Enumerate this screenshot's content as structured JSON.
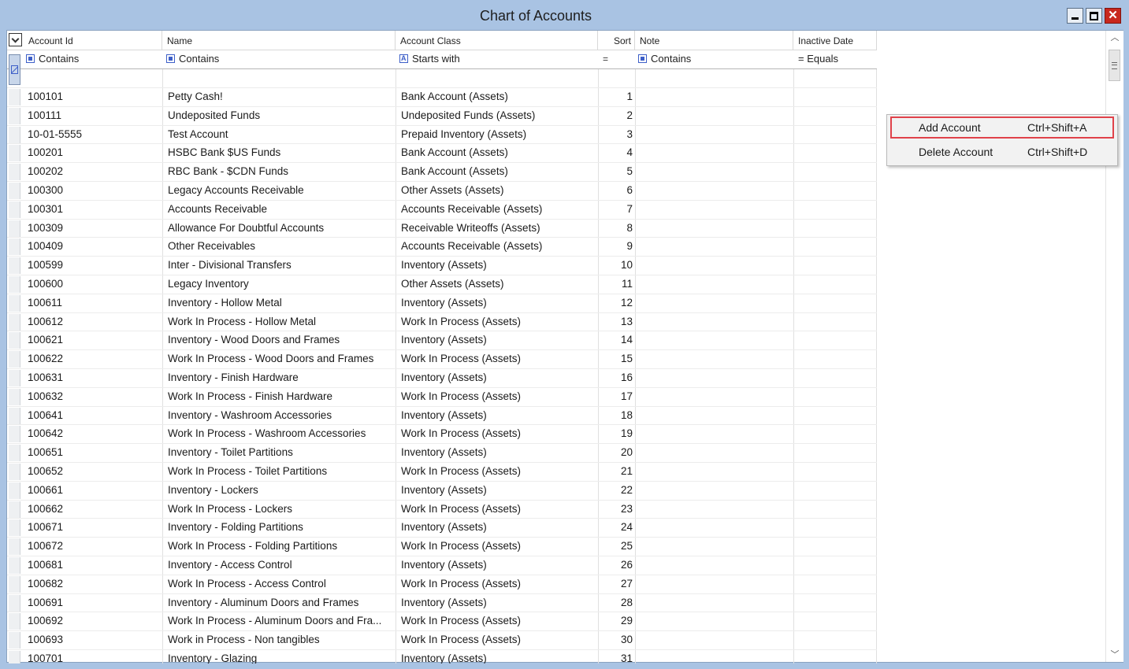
{
  "window": {
    "title": "Chart of Accounts",
    "close_glyph": "✕"
  },
  "columns": {
    "account_id": "Account Id",
    "name": "Name",
    "account_class": "Account Class",
    "sort": "Sort",
    "note": "Note",
    "inactive_date": "Inactive Date"
  },
  "filters": {
    "account_id": "Contains",
    "name": "Contains",
    "account_class": "Starts with",
    "sort": "=",
    "note": "Contains",
    "inactive_date": "= Equals"
  },
  "context_menu": {
    "items": [
      {
        "label": "Add Account",
        "shortcut": "Ctrl+Shift+A"
      },
      {
        "label": "Delete Account",
        "shortcut": "Ctrl+Shift+D"
      }
    ]
  },
  "rows": [
    {
      "id": "100101",
      "name": "Petty Cash!",
      "class": "Bank Account (Assets)",
      "sort": "1"
    },
    {
      "id": "100111",
      "name": "Undeposited Funds",
      "class": "Undeposited Funds (Assets)",
      "sort": "2"
    },
    {
      "id": "10-01-5555",
      "name": "Test Account",
      "class": "Prepaid Inventory (Assets)",
      "sort": "3"
    },
    {
      "id": "100201",
      "name": "HSBC Bank  $US Funds",
      "class": "Bank Account (Assets)",
      "sort": "4"
    },
    {
      "id": "100202",
      "name": "RBC Bank -  $CDN Funds",
      "class": "Bank Account (Assets)",
      "sort": "5"
    },
    {
      "id": "100300",
      "name": "Legacy Accounts Receivable",
      "class": "Other Assets (Assets)",
      "sort": "6"
    },
    {
      "id": "100301",
      "name": "Accounts Receivable",
      "class": "Accounts Receivable (Assets)",
      "sort": "7"
    },
    {
      "id": "100309",
      "name": "Allowance For Doubtful Accounts",
      "class": "Receivable Writeoffs (Assets)",
      "sort": "8"
    },
    {
      "id": "100409",
      "name": "Other Receivables",
      "class": "Accounts Receivable (Assets)",
      "sort": "9"
    },
    {
      "id": "100599",
      "name": "Inter - Divisional Transfers",
      "class": "Inventory (Assets)",
      "sort": "10"
    },
    {
      "id": "100600",
      "name": "Legacy Inventory",
      "class": "Other Assets (Assets)",
      "sort": "11"
    },
    {
      "id": "100611",
      "name": "Inventory - Hollow Metal",
      "class": "Inventory (Assets)",
      "sort": "12"
    },
    {
      "id": "100612",
      "name": "Work In Process - Hollow Metal",
      "class": "Work In Process (Assets)",
      "sort": "13"
    },
    {
      "id": "100621",
      "name": "Inventory - Wood Doors and Frames",
      "class": "Inventory (Assets)",
      "sort": "14"
    },
    {
      "id": "100622",
      "name": "Work In Process - Wood Doors and Frames",
      "class": "Work In Process (Assets)",
      "sort": "15"
    },
    {
      "id": "100631",
      "name": "Inventory - Finish Hardware",
      "class": "Inventory (Assets)",
      "sort": "16"
    },
    {
      "id": "100632",
      "name": "Work In Process - Finish Hardware",
      "class": "Work In Process (Assets)",
      "sort": "17"
    },
    {
      "id": "100641",
      "name": "Inventory - Washroom Accessories",
      "class": "Inventory (Assets)",
      "sort": "18"
    },
    {
      "id": "100642",
      "name": "Work In Process - Washroom Accessories",
      "class": "Work In Process (Assets)",
      "sort": "19"
    },
    {
      "id": "100651",
      "name": "Inventory - Toilet Partitions",
      "class": "Inventory (Assets)",
      "sort": "20"
    },
    {
      "id": "100652",
      "name": "Work In Process - Toilet Partitions",
      "class": "Work In Process (Assets)",
      "sort": "21"
    },
    {
      "id": "100661",
      "name": "Inventory - Lockers",
      "class": "Inventory (Assets)",
      "sort": "22"
    },
    {
      "id": "100662",
      "name": "Work In Process - Lockers",
      "class": "Work In Process (Assets)",
      "sort": "23"
    },
    {
      "id": "100671",
      "name": "Inventory - Folding Partitions",
      "class": "Inventory (Assets)",
      "sort": "24"
    },
    {
      "id": "100672",
      "name": "Work In Process - Folding Partitions",
      "class": "Work In Process (Assets)",
      "sort": "25"
    },
    {
      "id": "100681",
      "name": "Inventory - Access Control",
      "class": "Inventory (Assets)",
      "sort": "26"
    },
    {
      "id": "100682",
      "name": "Work In Process - Access Control",
      "class": "Work In Process (Assets)",
      "sort": "27"
    },
    {
      "id": "100691",
      "name": "Inventory - Aluminum Doors and Frames",
      "class": "Inventory (Assets)",
      "sort": "28"
    },
    {
      "id": "100692",
      "name": "Work In Process - Aluminum Doors and Fra...",
      "class": "Work In Process (Assets)",
      "sort": "29"
    },
    {
      "id": "100693",
      "name": "Work in Process - Non tangibles",
      "class": "Work In Process (Assets)",
      "sort": "30"
    },
    {
      "id": "100701",
      "name": "Inventory - Glazing",
      "class": "Inventory (Assets)",
      "sort": "31"
    }
  ]
}
